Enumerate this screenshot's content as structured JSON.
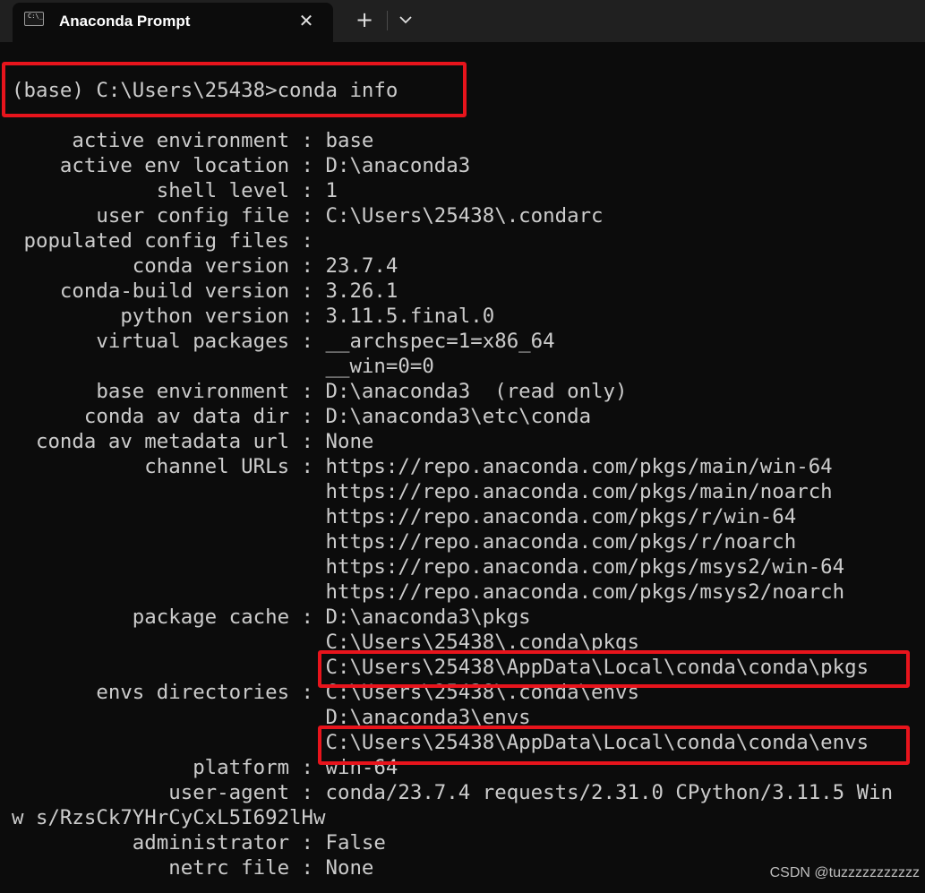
{
  "window": {
    "tab_title": "Anaconda Prompt",
    "tab_icon_text": "C:\\_",
    "close_label": "✕",
    "new_tab_label": "+",
    "icons": {
      "tab": "terminal-icon",
      "close": "close-icon",
      "new_tab": "plus-icon",
      "dropdown": "chevron-down-icon"
    }
  },
  "terminal": {
    "lines": [
      "(base) C:\\Users\\25438>conda info",
      "     active environment : base",
      "    active env location : D:\\anaconda3",
      "            shell level : 1",
      "       user config file : C:\\Users\\25438\\.condarc",
      " populated config files :",
      "          conda version : 23.7.4",
      "    conda-build version : 3.26.1",
      "         python version : 3.11.5.final.0",
      "       virtual packages : __archspec=1=x86_64",
      "                          __win=0=0",
      "       base environment : D:\\anaconda3  (read only)",
      "      conda av data dir : D:\\anaconda3\\etc\\conda",
      "  conda av metadata url : None",
      "           channel URLs : https://repo.anaconda.com/pkgs/main/win-64",
      "                          https://repo.anaconda.com/pkgs/main/noarch",
      "                          https://repo.anaconda.com/pkgs/r/win-64",
      "                          https://repo.anaconda.com/pkgs/r/noarch",
      "                          https://repo.anaconda.com/pkgs/msys2/win-64",
      "                          https://repo.anaconda.com/pkgs/msys2/noarch",
      "          package cache : D:\\anaconda3\\pkgs",
      "                          C:\\Users\\25438\\.conda\\pkgs",
      "                          C:\\Users\\25438\\AppData\\Local\\conda\\conda\\pkgs",
      "       envs directories : C:\\Users\\25438\\.conda\\envs",
      "                          D:\\anaconda3\\envs",
      "                          C:\\Users\\25438\\AppData\\Local\\conda\\conda\\envs",
      "               platform : win-64",
      "             user-agent : conda/23.7.4 requests/2.31.0 CPython/3.11.5 Win",
      "w s/RzsCk7YHrCyCxL5I692lHw",
      "          administrator : False",
      "             netrc file : None"
    ]
  },
  "highlight_color": "#e8141c",
  "watermark": "CSDN @tuzzzzzzzzzzz"
}
